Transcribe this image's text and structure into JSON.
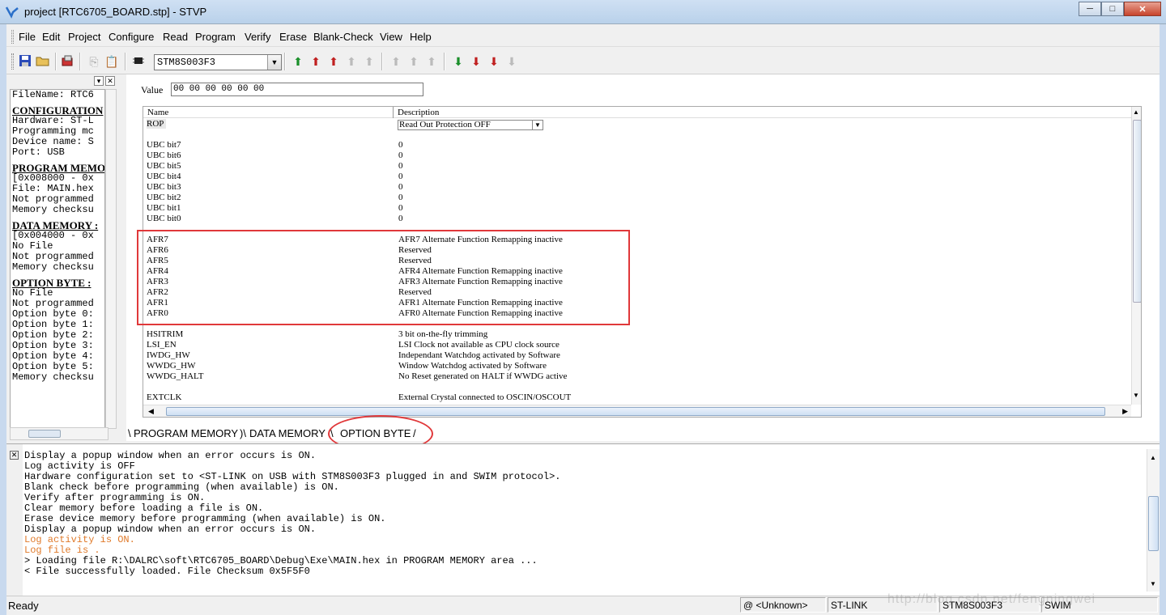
{
  "window": {
    "title": "project [RTC6705_BOARD.stp] - STVP",
    "minimize": "─",
    "maximize": "□",
    "close": "✕"
  },
  "menu": [
    "File",
    "Edit",
    "Project",
    "Configure",
    "Read",
    "Program",
    "Verify",
    "Erase",
    "Blank-Check",
    "View",
    "Help"
  ],
  "toolbar": {
    "device": "STM8S003F3"
  },
  "left_panel": {
    "lines": [
      {
        "t": "FileName: RTC6",
        "h": false
      },
      {
        "t": "CONFIGURATION",
        "h": true
      },
      {
        "t": "Hardware: ST-L",
        "h": false
      },
      {
        "t": "Programming mc",
        "h": false
      },
      {
        "t": "Device name: S",
        "h": false
      },
      {
        "t": "Port: USB",
        "h": false
      },
      {
        "t": "PROGRAM MEMOR",
        "h": true
      },
      {
        "t": "[0x008000 - 0x",
        "h": false
      },
      {
        "t": "File: MAIN.hex",
        "h": false
      },
      {
        "t": "Not programmed",
        "h": false
      },
      {
        "t": "Memory checksu",
        "h": false
      },
      {
        "t": "DATA MEMORY :",
        "h": true
      },
      {
        "t": "[0x004000 - 0x",
        "h": false
      },
      {
        "t": "No File",
        "h": false
      },
      {
        "t": "Not programmed",
        "h": false
      },
      {
        "t": "Memory checksu",
        "h": false
      },
      {
        "t": "OPTION BYTE :",
        "h": true
      },
      {
        "t": "No File",
        "h": false
      },
      {
        "t": "Not programmed",
        "h": false
      },
      {
        "t": "Option byte 0:",
        "h": false
      },
      {
        "t": "Option byte 1:",
        "h": false
      },
      {
        "t": "Option byte 2:",
        "h": false
      },
      {
        "t": "Option byte 3:",
        "h": false
      },
      {
        "t": "Option byte 4:",
        "h": false
      },
      {
        "t": "Option byte 5:",
        "h": false
      },
      {
        "t": "Memory checksu",
        "h": false
      }
    ]
  },
  "value_field": {
    "label": "Value",
    "value": "00 00 00 00 00 00"
  },
  "grid": {
    "headers": {
      "name": "Name",
      "description": "Description"
    },
    "rop": {
      "name": "ROP",
      "description": "Read Out Protection OFF"
    },
    "rows": [
      {
        "name": "UBC bit7",
        "desc": "0"
      },
      {
        "name": "UBC bit6",
        "desc": "0"
      },
      {
        "name": "UBC bit5",
        "desc": "0"
      },
      {
        "name": "UBC bit4",
        "desc": "0"
      },
      {
        "name": "UBC bit3",
        "desc": "0"
      },
      {
        "name": "UBC bit2",
        "desc": "0"
      },
      {
        "name": "UBC bit1",
        "desc": "0"
      },
      {
        "name": "UBC bit0",
        "desc": "0"
      },
      {
        "name": "",
        "desc": ""
      },
      {
        "name": "AFR7",
        "desc": "AFR7 Alternate Function Remapping inactive"
      },
      {
        "name": "AFR6",
        "desc": "Reserved"
      },
      {
        "name": "AFR5",
        "desc": "Reserved"
      },
      {
        "name": "AFR4",
        "desc": "AFR4 Alternate Function Remapping inactive"
      },
      {
        "name": "AFR3",
        "desc": "AFR3 Alternate Function Remapping inactive"
      },
      {
        "name": "AFR2",
        "desc": "Reserved"
      },
      {
        "name": "AFR1",
        "desc": "AFR1 Alternate Function Remapping inactive"
      },
      {
        "name": "AFR0",
        "desc": "AFR0 Alternate Function Remapping inactive"
      },
      {
        "name": "",
        "desc": ""
      },
      {
        "name": "HSITRIM",
        "desc": "3 bit on-the-fly trimming"
      },
      {
        "name": "LSI_EN",
        "desc": "LSI Clock not available as CPU clock source"
      },
      {
        "name": "IWDG_HW",
        "desc": "Independant Watchdog activated by Software"
      },
      {
        "name": "WWDG_HW",
        "desc": "Window Watchdog activated by Software"
      },
      {
        "name": "WWDG_HALT",
        "desc": "No Reset generated on HALT if WWDG active"
      },
      {
        "name": "",
        "desc": ""
      },
      {
        "name": "EXTCLK",
        "desc": "External Crystal connected to OSCIN/OSCOUT"
      }
    ]
  },
  "tabs": [
    "PROGRAM MEMORY",
    "DATA MEMORY",
    "OPTION BYTE"
  ],
  "output": {
    "lines": [
      {
        "t": "Display a popup window when an error occurs is ON.",
        "c": ""
      },
      {
        "t": "Log activity is OFF",
        "c": ""
      },
      {
        "t": "Hardware configuration set to <ST-LINK on USB with STM8S003F3 plugged in and SWIM protocol>.",
        "c": ""
      },
      {
        "t": "Blank check before programming (when available) is ON.",
        "c": ""
      },
      {
        "t": "Verify after programming is ON.",
        "c": ""
      },
      {
        "t": "Clear memory before loading a file is ON.",
        "c": ""
      },
      {
        "t": "Erase device memory before programming (when available) is ON.",
        "c": ""
      },
      {
        "t": "Display a popup window when an error occurs is ON.",
        "c": ""
      },
      {
        "t": "Log activity is ON.",
        "c": "orange"
      },
      {
        "t": "Log file is .",
        "c": "orange"
      },
      {
        "t": "> Loading file R:\\DALRC\\soft\\RTC6705_BOARD\\Debug\\Exe\\MAIN.hex in PROGRAM MEMORY area  ...",
        "c": ""
      },
      {
        "t": "< File successfully loaded. File Checksum 0x5F5F0",
        "c": ""
      }
    ]
  },
  "status": {
    "ready": "Ready",
    "unknown": "@ <Unknown>",
    "link": "ST-LINK",
    "device": "STM8S003F3",
    "protocol": "SWIM"
  },
  "watermark": "http://blog.csdn.net/fengningwei"
}
